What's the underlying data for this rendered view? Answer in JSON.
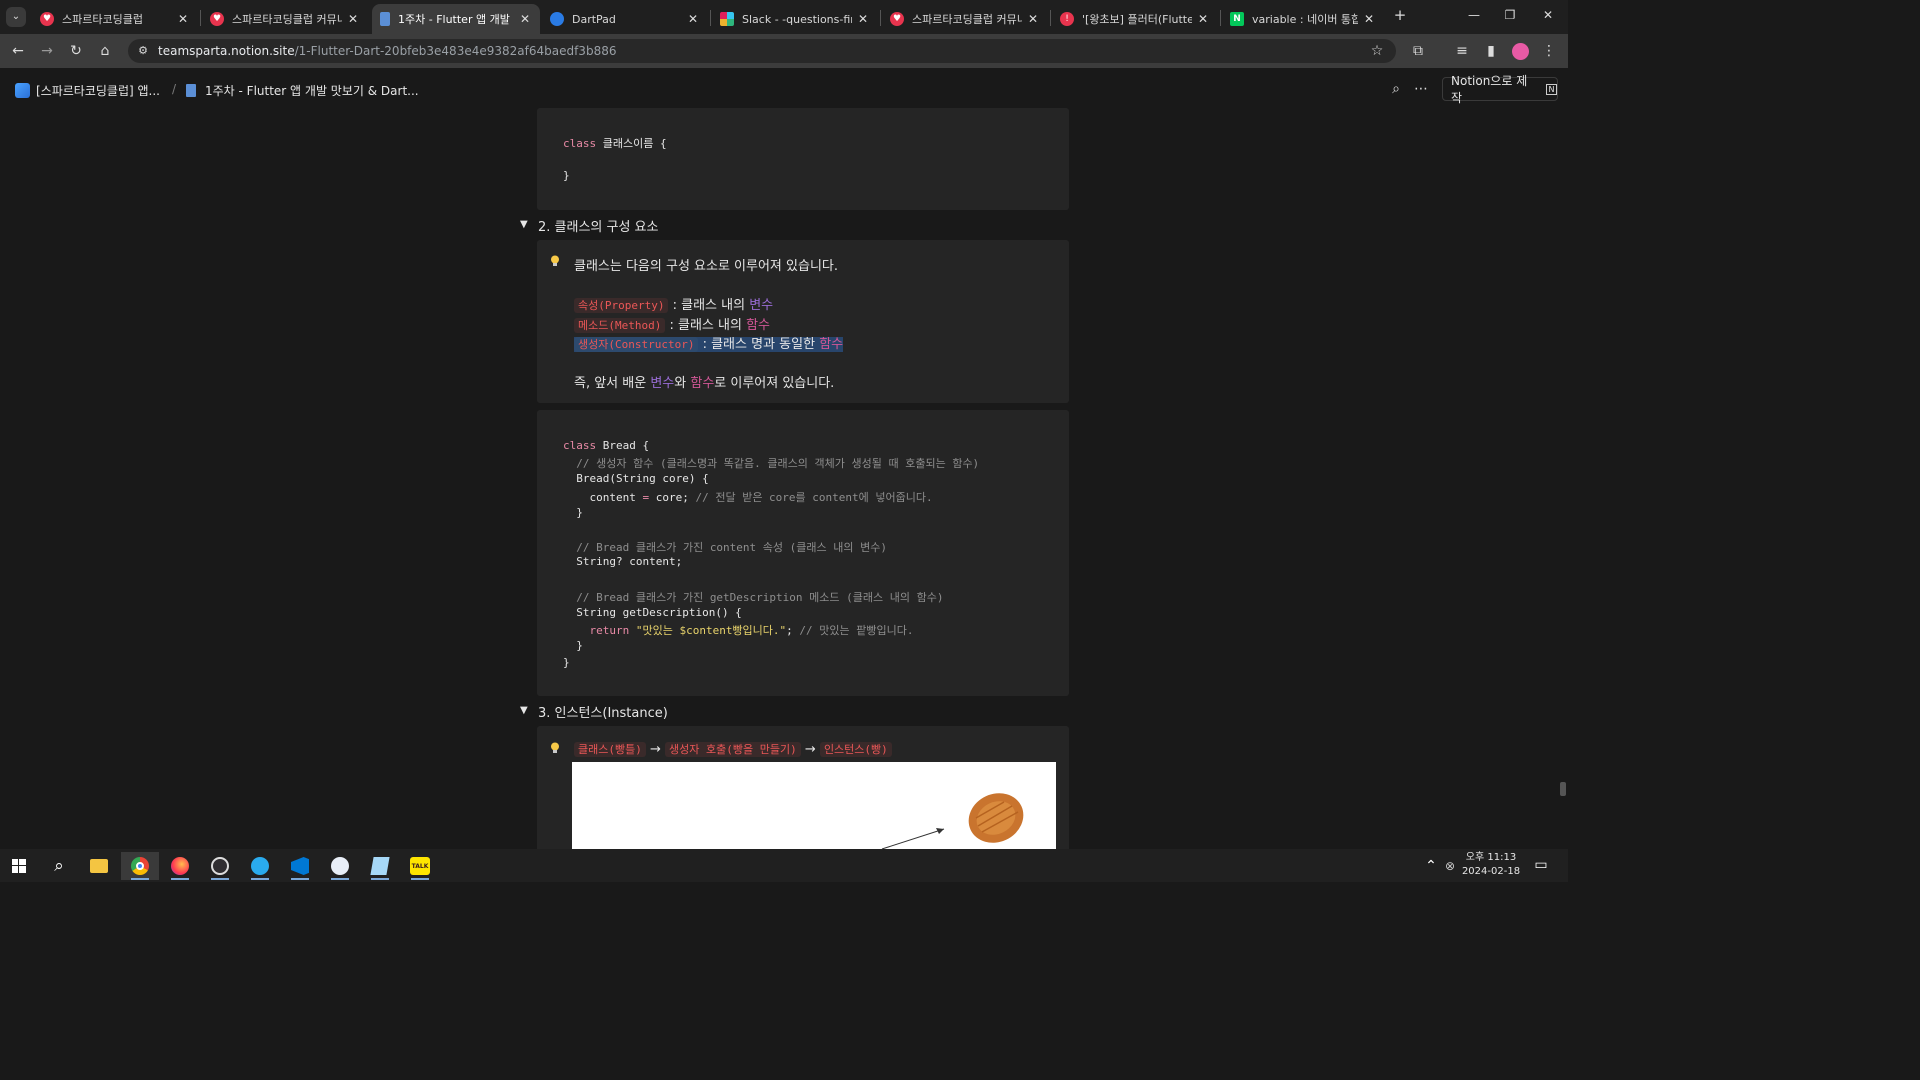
{
  "browser": {
    "tabs": [
      {
        "label": "스파르타코딩클럽",
        "favicon_color": "#e8344e",
        "active": false
      },
      {
        "label": "스파르타코딩클럽 커뮤니",
        "favicon_color": "#e8344e",
        "active": false
      },
      {
        "label": "1주차 - Flutter 앱 개발 맛",
        "favicon_color": "#5b8fd6",
        "active": true
      },
      {
        "label": "DartPad",
        "favicon_color": "#2a7be4",
        "active": false
      },
      {
        "label": "Slack - -questions-fireba",
        "favicon_color": "#e01e5a",
        "active": false
      },
      {
        "label": "스파르타코딩클럽 커뮤니",
        "favicon_color": "#e8344e",
        "active": false
      },
      {
        "label": "'[왕초보] 플러터(Flutter)",
        "favicon_color": "#e8344e",
        "active": false
      },
      {
        "label": "variable : 네이버 통합검",
        "favicon_color": "#03c75a",
        "active": false
      }
    ],
    "new_tab_icon": "+",
    "url_domain": "teamsparta.notion.site",
    "url_path": "/1-Flutter-Dart-20bfeb3e483e4e9382af64baedf3b886"
  },
  "notion": {
    "breadcrumb_workspace": "[스파르타코딩클럽] 앱...",
    "breadcrumb_sep": "/",
    "breadcrumb_page": "1주차 - Flutter 앱 개발 맛보기 & Dart...",
    "made_with_label": "Notion으로 제작"
  },
  "content": {
    "code1": {
      "line1_kw": "class",
      "line1_rest": " 클래스이름 {",
      "line2": "}"
    },
    "section2_title": "2. 클래스의 구성 요소",
    "callout1": {
      "intro": "클래스는 다음의 구성 요소로 이루어져 있습니다.",
      "property_code": "속성(Property)",
      "property_text": " : 클래스 내의 ",
      "property_word": "변수",
      "method_code": "메소드(Method)",
      "method_text": " : 클래스 내의 ",
      "method_word": "함수",
      "ctor_code": "생성자(Constructor)",
      "ctor_text": " : 클래스 명과 동일한 ",
      "ctor_word": "함수",
      "summary_a": "즉, 앞서 배운 ",
      "summary_var": "변수",
      "summary_b": "와 ",
      "summary_func": "함수",
      "summary_c": "로 이루어져 있습니다."
    },
    "code2": {
      "l1_kw": "class",
      "l1_rest": " Bread {",
      "l2": "  // 생성자 함수 (클래스명과 똑같음. 클래스의 객체가 생성될 때 호출되는 함수)",
      "l3": "  Bread(String core) {",
      "l4_a": "    content ",
      "l4_op": "=",
      "l4_b": " core; ",
      "l4_cm": "// 전달 받은 core를 content에 넣어줍니다.",
      "l5": "  }",
      "l6": "  // Bread 클래스가 가진 content 속성 (클래스 내의 변수)",
      "l7": "  String? content;",
      "l8": "  // Bread 클래스가 가진 getDescription 메소드 (클래스 내의 함수)",
      "l9": "  String getDescription() {",
      "l10_kw": "    return",
      "l10_str": " \"맛있는 $content빵입니다.\"",
      "l10_b": "; ",
      "l10_cm": "// 맛있는 팥빵입니다.",
      "l11": "  }",
      "l12": "}"
    },
    "section3_title": "3. 인스턴스(Instance)",
    "callout2": {
      "step1": "클래스(빵틀)",
      "arrow": "→",
      "step2": "생성자 호출(빵을 만들기)",
      "step3": "인스턴스(빵)"
    }
  },
  "taskbar": {
    "time": "오후 11:13",
    "date": "2024-02-18"
  },
  "colors": {
    "page_bg": "#191919",
    "block_bg": "#252525",
    "inline_code": "#eb5757",
    "purple": "#9a6dd7",
    "pink": "#d15796",
    "highlight_blue": "#28456c"
  }
}
